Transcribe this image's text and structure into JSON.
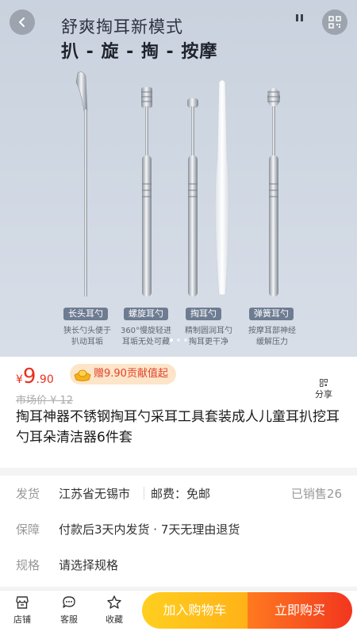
{
  "hero": {
    "title_line1": "舒爽掏耳新模式",
    "title_line2": "扒 - 旋 - 掏 - 按摩",
    "tools": [
      {
        "label": "长头耳勺",
        "desc_line1": "狭长勺头便于",
        "desc_line2": "扒动耳垢"
      },
      {
        "label": "螺旋耳勺",
        "desc_line1": "360°慢旋轻进",
        "desc_line2": "耳垢无处可藏"
      },
      {
        "label": "掏耳勺",
        "desc_line1": "精制圆润耳勺",
        "desc_line2": "掏耳更干净"
      },
      {
        "label": "弹簧耳勺",
        "desc_line1": "按摩耳部神经",
        "desc_line2": "缓解压力"
      }
    ],
    "carousel": {
      "total": 3,
      "active": 0
    }
  },
  "product": {
    "currency": "¥",
    "price_int": "9",
    "price_dec": ".90",
    "gift_text": "赠9.90贡献值起",
    "market_price": "市场价 ¥ 12",
    "share_label": "分享",
    "title": "掏耳神器不锈钢掏耳勺采耳工具套装成人儿童耳扒挖耳勺耳朵清洁器6件套"
  },
  "info": {
    "shipping_label": "发货",
    "shipping_from": "江苏省无锡市",
    "postage": "邮费：免邮",
    "sold": "已销售26",
    "guarantee_label": "保障",
    "guarantee_text": "付款后3天内发货 · 7天无理由退货",
    "spec_label": "规格",
    "spec_text": "请选择规格"
  },
  "bottom_bar": {
    "store_label": "店铺",
    "service_label": "客服",
    "favorite_label": "收藏",
    "add_to_cart": "加入购物车",
    "buy_now": "立即购买"
  },
  "colors": {
    "accent_red": "#e8301f",
    "cart_yellow": "#ffb217",
    "buy_orange": "#f2361f",
    "tag_bg": "#6e7c92"
  }
}
